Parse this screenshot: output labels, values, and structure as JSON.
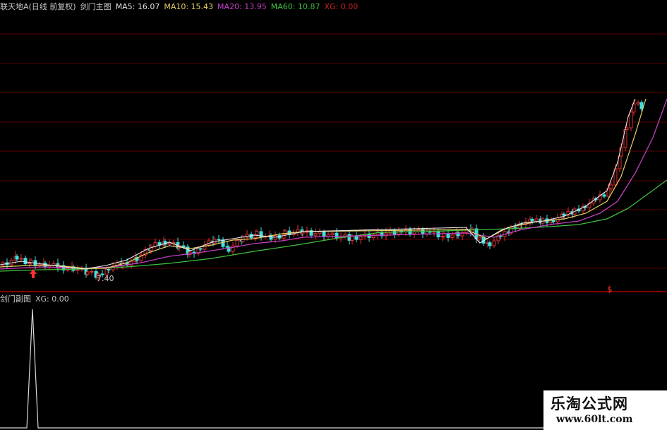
{
  "main_header": {
    "stock_title": "联天地A(日线 前复权)",
    "indicator_name": "剑门主图",
    "ma5": "MA5: 16.07",
    "ma10": "MA10: 15.43",
    "ma20": "MA20: 13.95",
    "ma60": "MA60: 10.87",
    "xg": "XG: 0.00"
  },
  "sub_header": {
    "indicator_name": "剑门副图",
    "xg": "XG: 0.00"
  },
  "low_price_label": "7.40",
  "watermark": {
    "line1": "乐淘公式网",
    "line2": "www.60lt.com"
  },
  "colors": {
    "background": "#000000",
    "grid": "#7a0000",
    "divider": "#b00000",
    "ma5": "#e6e6e6",
    "ma10": "#e6d06a",
    "ma20": "#c040c0",
    "ma60": "#40c040",
    "xg": "#d02020",
    "up_candle": "#e03030",
    "down_candle": "#40e0e0",
    "sub_line": "#d8d8d8"
  },
  "icons": {
    "buy_signal": "red-up-arrow-icon",
    "sell_signal": "red-dollar-icon"
  }
}
